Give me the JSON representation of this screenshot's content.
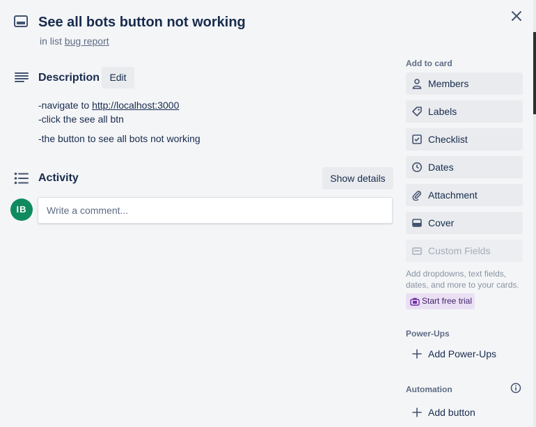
{
  "card": {
    "title": "See all bots button not working",
    "in_list_prefix": "in list",
    "list_name": "bug report",
    "icon": "card-icon",
    "close_icon": "close-icon"
  },
  "description": {
    "heading": "Description",
    "edit_label": "Edit",
    "line1_prefix": "-navigate to ",
    "line1_link": "http://localhost:3000",
    "line2": "-click the see all btn",
    "line3": "-the button to see all bots not working"
  },
  "activity": {
    "heading": "Activity",
    "show_details_label": "Show details",
    "avatar_initials": "IB",
    "avatar_color": "#0f8b5f",
    "comment_placeholder": "Write a comment..."
  },
  "sidebar": {
    "add_to_card_heading": "Add to card",
    "buttons": [
      {
        "label": "Members",
        "icon": "person-icon"
      },
      {
        "label": "Labels",
        "icon": "tag-icon"
      },
      {
        "label": "Checklist",
        "icon": "checkbox-icon"
      },
      {
        "label": "Dates",
        "icon": "clock-icon"
      },
      {
        "label": "Attachment",
        "icon": "paperclip-icon"
      },
      {
        "label": "Cover",
        "icon": "cover-icon"
      },
      {
        "label": "Custom Fields",
        "icon": "custom-fields-icon",
        "disabled": true
      }
    ],
    "custom_fields_hint": "Add dropdowns, text fields, dates, and more to your cards.",
    "trial_label": "Start free trial",
    "powerups_heading": "Power-Ups",
    "add_powerups_label": "Add Power-Ups",
    "automation_heading": "Automation",
    "add_button_label": "Add button"
  },
  "colors": {
    "background": "#f4f5f7",
    "text": "#172b4d",
    "muted": "#5e6c84",
    "button_bg": "#e9ebee",
    "trial_bg": "#eae0f3"
  }
}
